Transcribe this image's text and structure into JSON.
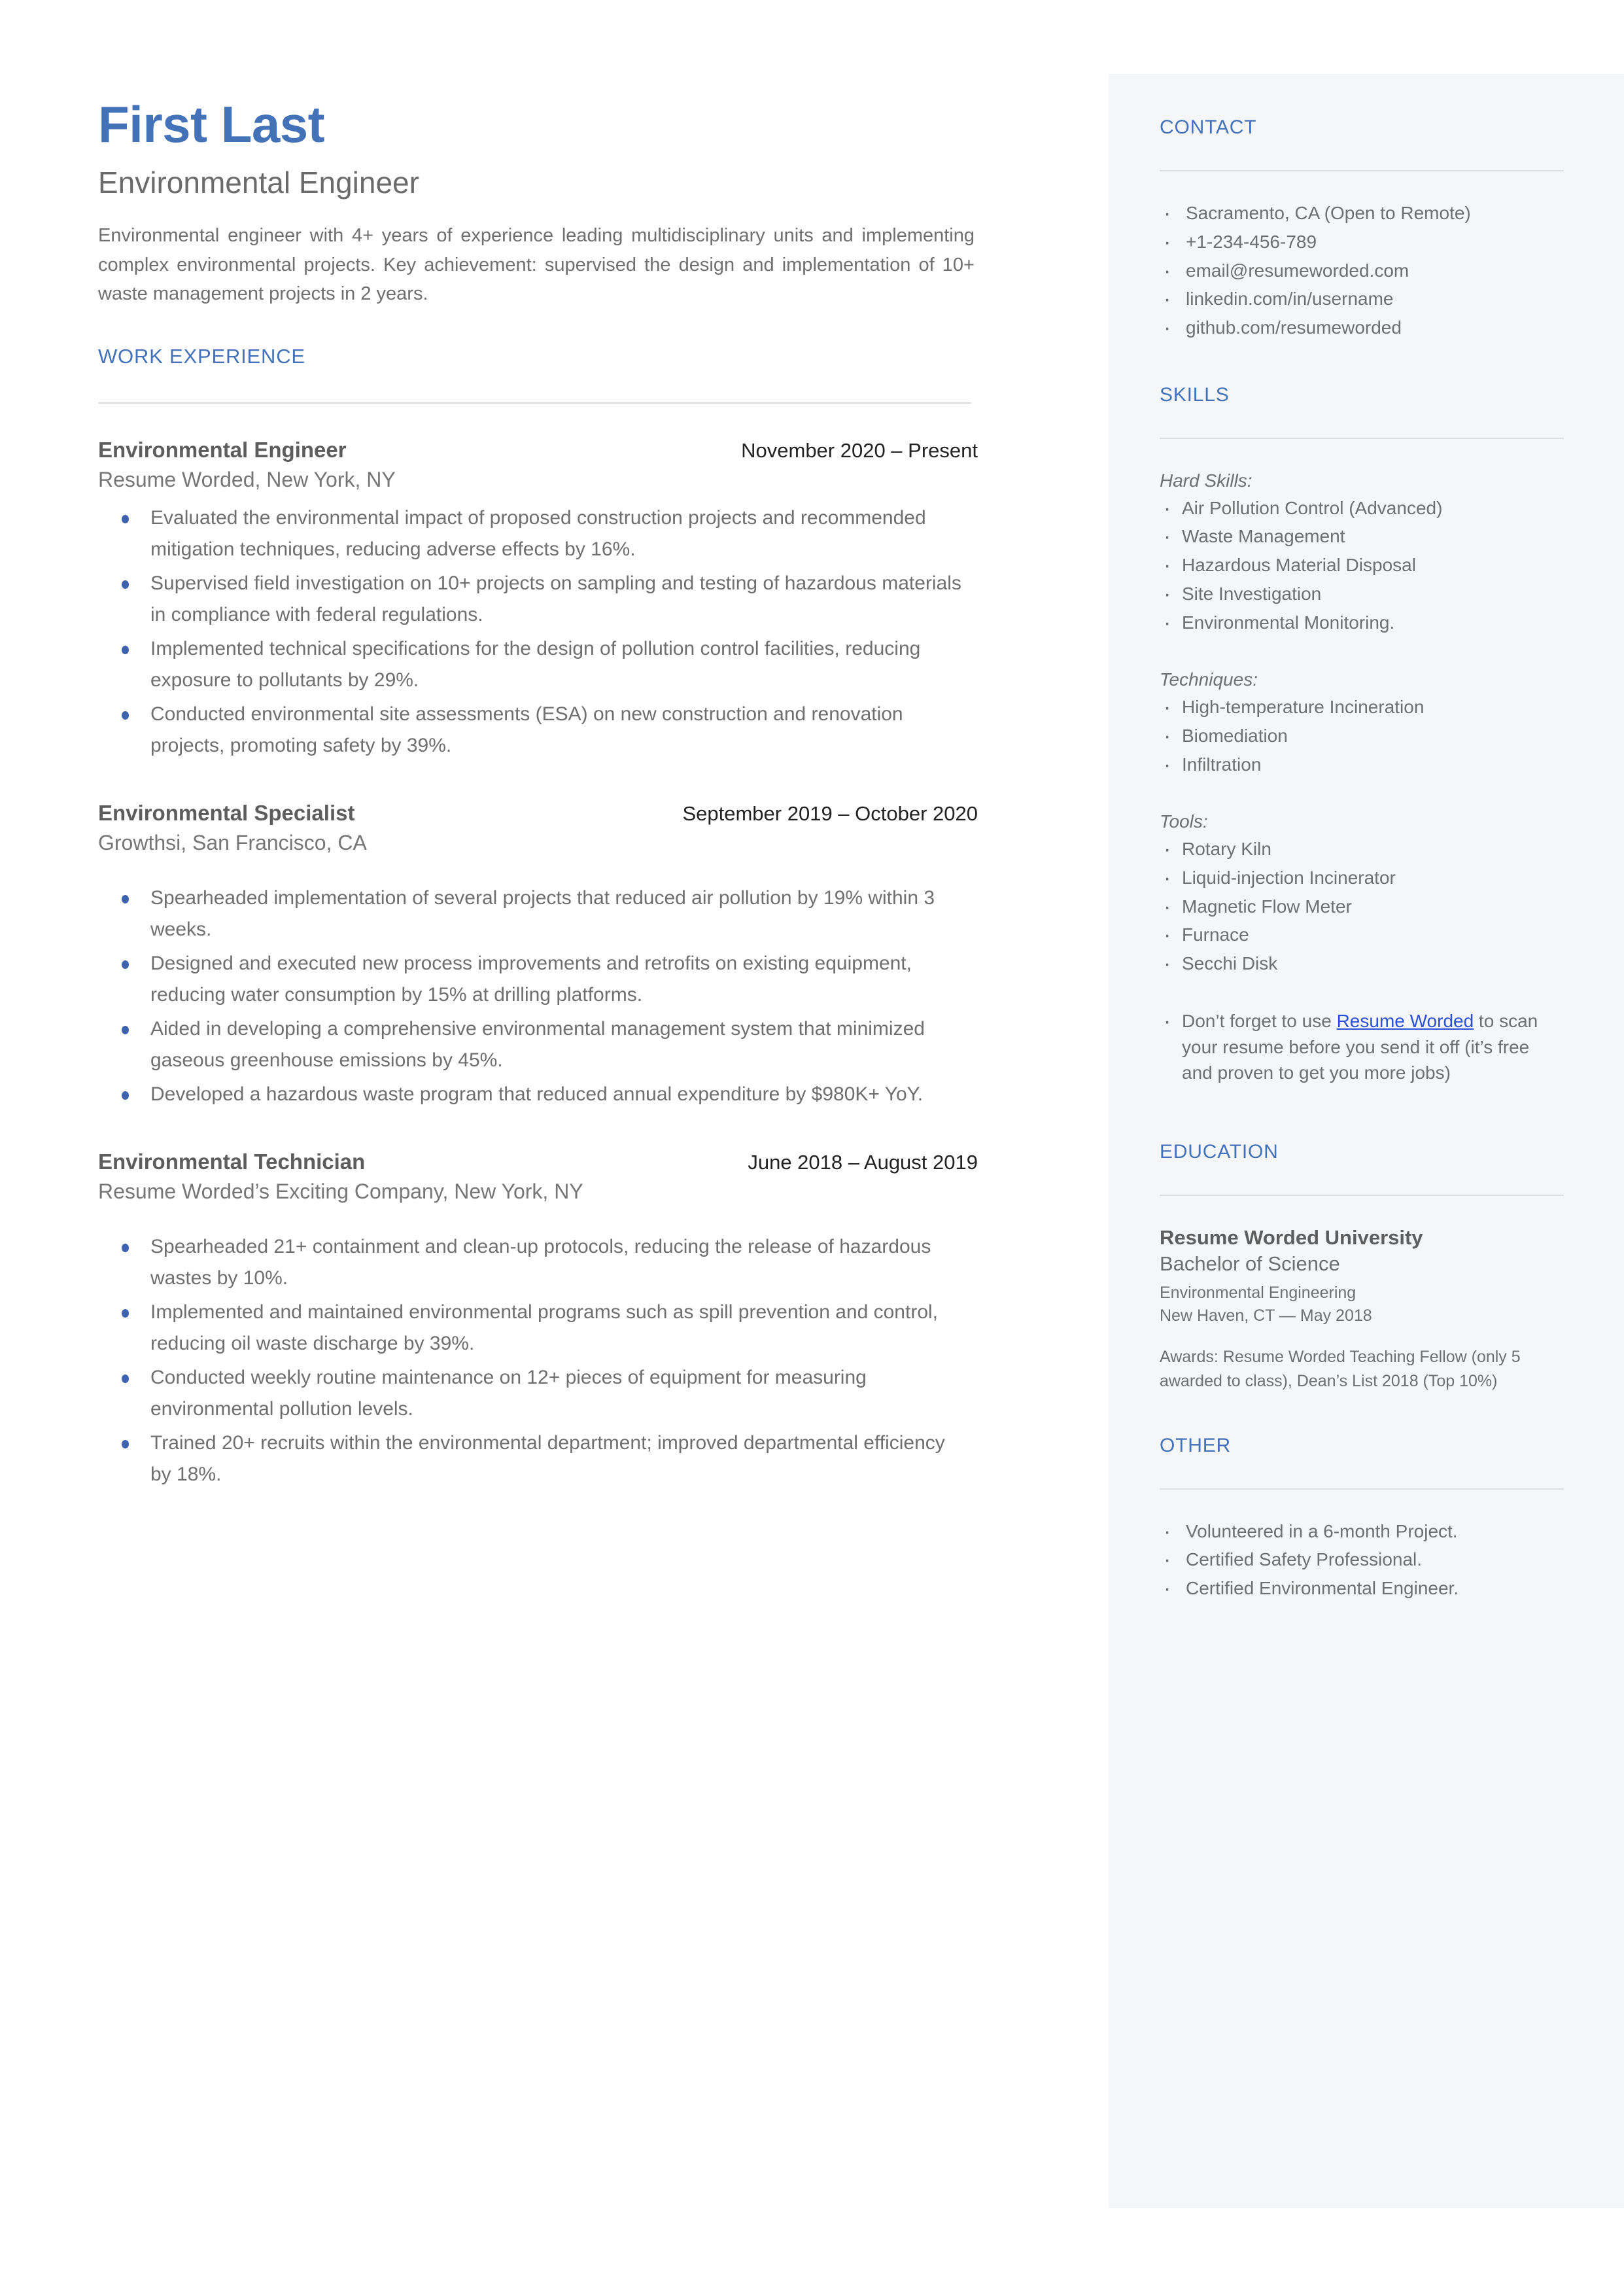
{
  "colors": {
    "accent": "#4472b8",
    "link": "#2b4fd6",
    "body_text": "#6f6f6f",
    "sidebar_bg": "#f4f6f8",
    "bullet": "#3d63b0"
  },
  "header": {
    "name": "First Last",
    "job_title": "Environmental Engineer",
    "summary": "Environmental engineer with 4+ years of experience leading multidisciplinary units and implementing complex environmental projects. Key achievement: supervised the design and implementation of 10+ waste management projects in 2 years."
  },
  "work_experience": {
    "section_title": "WORK EXPERIENCE",
    "jobs": [
      {
        "role": "Environmental Engineer",
        "dates": "November 2020 – Present",
        "company": "Resume Worded, New York, NY",
        "bullets": [
          "Evaluated the environmental impact of proposed construction projects and recommended mitigation techniques, reducing adverse effects by 16%.",
          "Supervised field investigation on 10+ projects on sampling and testing of hazardous materials in compliance with federal regulations.",
          "Implemented technical specifications for the design of pollution control facilities, reducing exposure to pollutants by 29%.",
          "Conducted environmental site assessments (ESA) on new construction and renovation projects, promoting safety by 39%."
        ]
      },
      {
        "role": "Environmental Specialist",
        "dates": "September 2019 – October 2020",
        "company": "Growthsi, San Francisco, CA",
        "bullets": [
          "Spearheaded implementation of several projects that reduced air pollution by 19% within 3 weeks.",
          "Designed and executed new process improvements and retrofits on existing equipment, reducing water consumption by 15% at drilling platforms.",
          "Aided in developing a comprehensive environmental management system that minimized gaseous greenhouse emissions by 45%.",
          "Developed a hazardous waste program that reduced annual expenditure by $980K+ YoY."
        ]
      },
      {
        "role": "Environmental Technician",
        "dates": "June 2018 – August 2019",
        "company": "Resume Worded’s Exciting Company, New York, NY",
        "bullets": [
          "Spearheaded 21+ containment and clean-up protocols, reducing the release of hazardous wastes by 10%.",
          "Implemented and maintained environmental programs such as spill prevention and control, reducing oil waste discharge by 39%.",
          "Conducted weekly routine maintenance on 12+ pieces of equipment for measuring environmental pollution levels.",
          "Trained 20+ recruits within the environmental department; improved departmental efficiency by 18%."
        ]
      }
    ]
  },
  "sidebar": {
    "contact": {
      "title": "CONTACT",
      "items": [
        "Sacramento, CA (Open to Remote)",
        "+1-234-456-789",
        "email@resumeworded.com",
        "linkedin.com/in/username",
        "github.com/resumeworded"
      ]
    },
    "skills": {
      "title": "SKILLS",
      "groups": [
        {
          "label": "Hard Skills:",
          "items": [
            "Air Pollution Control (Advanced)",
            "Waste Management",
            "Hazardous Material Disposal",
            "Site Investigation",
            "Environmental Monitoring."
          ]
        },
        {
          "label": "Techniques:",
          "items": [
            "High-temperature Incineration",
            "Biomediation",
            "Infiltration"
          ]
        },
        {
          "label": "Tools:",
          "items": [
            "Rotary Kiln",
            "Liquid-injection Incinerator",
            "Magnetic Flow Meter",
            "Furnace",
            "Secchi Disk"
          ]
        }
      ],
      "note": {
        "prefix": "Don’t forget to use ",
        "link": "Resume Worded",
        "suffix": " to scan your resume before you send it off (it’s free and proven to get you more jobs)"
      }
    },
    "education": {
      "title": "EDUCATION",
      "school": "Resume Worded University",
      "degree": "Bachelor of Science",
      "field": "Environmental Engineering",
      "location_date": "New Haven, CT — May 2018",
      "awards": "Awards: Resume Worded Teaching Fellow (only 5 awarded to class), Dean’s List 2018 (Top 10%)"
    },
    "other": {
      "title": "OTHER",
      "items": [
        "Volunteered in a 6-month Project.",
        "Certified Safety Professional.",
        "Certified Environmental Engineer."
      ]
    }
  }
}
